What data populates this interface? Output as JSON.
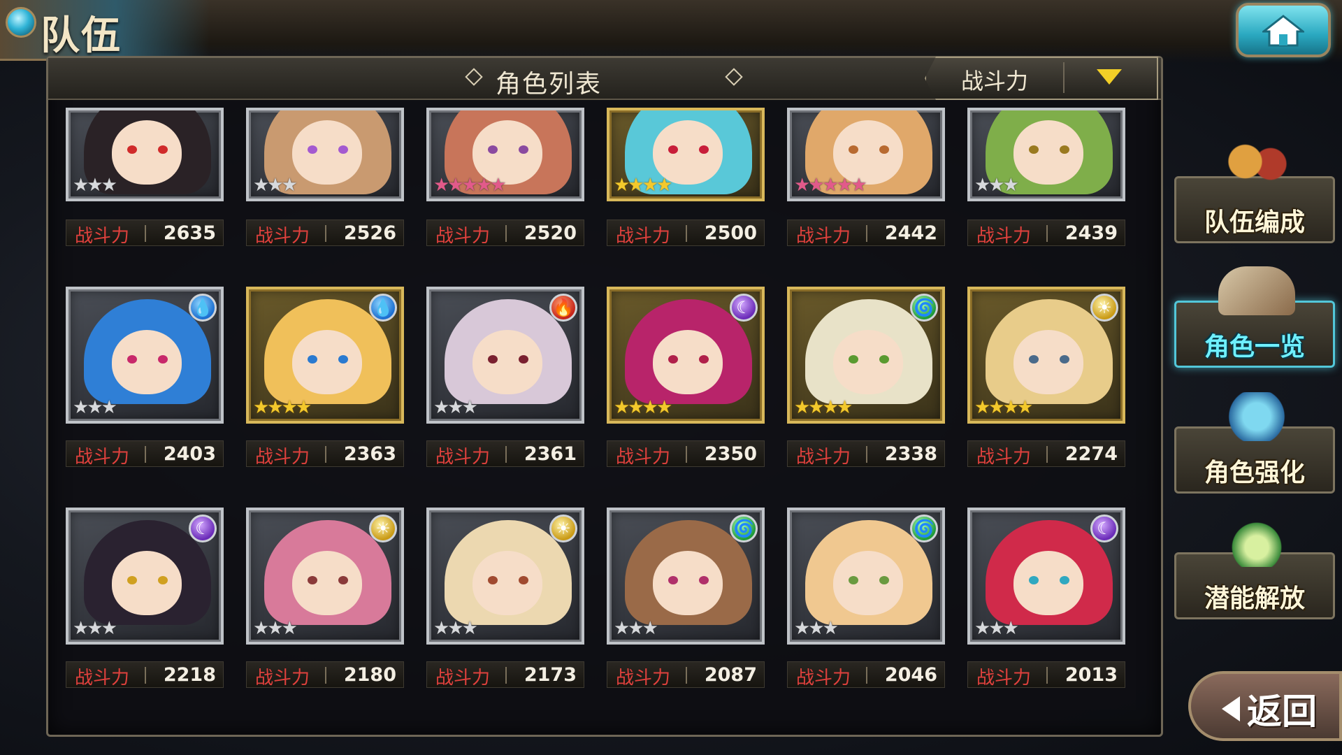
{
  "header": {
    "screen_title": "队伍",
    "list_title": "角色列表",
    "sort_label": "战斗力"
  },
  "power_label": "战斗力",
  "characters": [
    {
      "power": "2635",
      "stars": 3,
      "rarity": "silver",
      "element": null,
      "hair": "#2a2226",
      "eyes": "#d02a2a"
    },
    {
      "power": "2526",
      "stars": 3,
      "rarity": "silver",
      "element": null,
      "hair": "#c99a70",
      "eyes": "#a45ad0"
    },
    {
      "power": "2520",
      "stars": 5,
      "rarity": "silver",
      "element": null,
      "hair": "#c8755a",
      "eyes": "#8a4aa0"
    },
    {
      "power": "2500",
      "stars": 4,
      "rarity": "gold",
      "element": null,
      "hair": "#59c8d8",
      "eyes": "#c81e3a"
    },
    {
      "power": "2442",
      "stars": 5,
      "rarity": "silver",
      "element": null,
      "hair": "#e0a86a",
      "eyes": "#b86a30"
    },
    {
      "power": "2439",
      "stars": 3,
      "rarity": "silver",
      "element": null,
      "hair": "#7fae4a",
      "eyes": "#9a7a20"
    },
    {
      "power": "2403",
      "stars": 3,
      "rarity": "silver",
      "element": "water",
      "hair": "#2f7fd6",
      "eyes": "#c8286a"
    },
    {
      "power": "2363",
      "stars": 4,
      "rarity": "gold",
      "element": "water",
      "hair": "#f0c05a",
      "eyes": "#2a7ad0"
    },
    {
      "power": "2361",
      "stars": 3,
      "rarity": "silver",
      "element": "fire",
      "hair": "#d8c8d8",
      "eyes": "#7a2030"
    },
    {
      "power": "2350",
      "stars": 4,
      "rarity": "gold",
      "element": "dark",
      "hair": "#b8246a",
      "eyes": "#b0204a"
    },
    {
      "power": "2338",
      "stars": 4,
      "rarity": "gold",
      "element": "wind",
      "hair": "#e8e2c8",
      "eyes": "#5a9a30"
    },
    {
      "power": "2274",
      "stars": 4,
      "rarity": "gold",
      "element": "light",
      "hair": "#e8cc8a",
      "eyes": "#4a6a8a"
    },
    {
      "power": "2218",
      "stars": 3,
      "rarity": "silver",
      "element": "dark",
      "hair": "#2a2230",
      "eyes": "#d0a020"
    },
    {
      "power": "2180",
      "stars": 3,
      "rarity": "silver",
      "element": "light",
      "hair": "#d87a9a",
      "eyes": "#8a3a3a"
    },
    {
      "power": "2173",
      "stars": 3,
      "rarity": "silver",
      "element": "light",
      "hair": "#ecd8b0",
      "eyes": "#a04a30"
    },
    {
      "power": "2087",
      "stars": 3,
      "rarity": "silver",
      "element": "wind",
      "hair": "#9a6a48",
      "eyes": "#b0306a"
    },
    {
      "power": "2046",
      "stars": 3,
      "rarity": "silver",
      "element": "wind",
      "hair": "#f0c890",
      "eyes": "#6a9a40"
    },
    {
      "power": "2013",
      "stars": 3,
      "rarity": "silver",
      "element": "dark",
      "hair": "#d02a4a",
      "eyes": "#30a8c0"
    }
  ],
  "side_menu": [
    {
      "label": "队伍编成",
      "icon": "team-members-icon",
      "active": false
    },
    {
      "label": "角色一览",
      "icon": "book-icon",
      "active": true
    },
    {
      "label": "角色强化",
      "icon": "enhance-icon",
      "active": false
    },
    {
      "label": "潜能解放",
      "icon": "potential-orb-icon",
      "active": false
    }
  ],
  "back_label": "返回",
  "colors": {
    "power_label": "#e0413d",
    "active_menu": "#6ff0ff",
    "sort_arrow": "#f3cf27"
  }
}
